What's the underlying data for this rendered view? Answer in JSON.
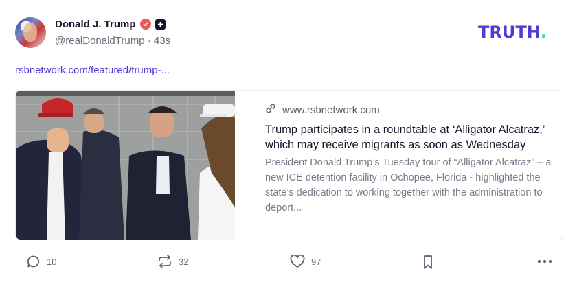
{
  "post": {
    "author_name": "Donald J. Trump",
    "handle": "@realDonaldTrump",
    "separator": "·",
    "time": "43s",
    "link_text": "rsbnetwork.com/featured/trump-..."
  },
  "brand": {
    "logo_main": "TRUTH",
    "logo_dot": ".",
    "accent": "#4f3bd6",
    "dot_color": "#39d0c3"
  },
  "card": {
    "domain": "www.rsbnetwork.com",
    "title": "Trump participates in a roundtable at ‘Alligator Alcatraz,’ which may receive migrants as soon as Wednesday",
    "description": "President Donald Trump’s Tuesday tour of “Alligator Alcatraz” – a new ICE detention facility in Ochopee, Florida - highlighted the state’s dedication to working together with the administration to deport...",
    "image_alt": "Photo of Trump in red MAGA cap with DeSantis and others"
  },
  "actions": {
    "replies": "10",
    "retruths": "32",
    "likes": "97"
  },
  "icons": [
    "link-icon",
    "reply-icon",
    "retruth-icon",
    "heart-icon",
    "bookmark-icon",
    "more-icon",
    "verified-icon",
    "plus-badge-icon"
  ]
}
